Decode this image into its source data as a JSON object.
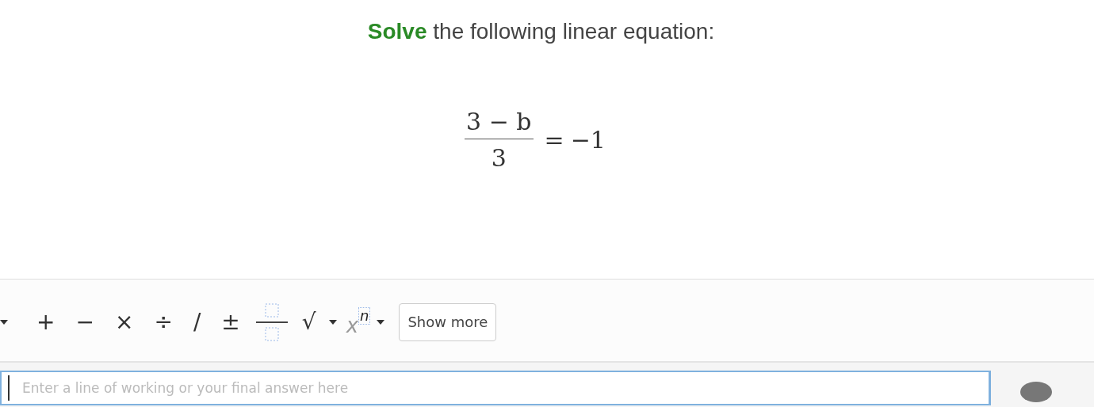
{
  "question": {
    "prompt": "**Solve** the following linear equation:",
    "equation": {
      "numerator": "3 − b",
      "denominator": "3",
      "relation": "=",
      "right_side": "−1"
    }
  },
  "toolbar": [
    {
      "kind": "caret"
    },
    {
      "kind": "symbol",
      "label": "+"
    },
    {
      "kind": "symbol",
      "label": "−"
    },
    {
      "kind": "symbol",
      "label": "×"
    },
    {
      "kind": "symbol",
      "label": "÷"
    },
    {
      "kind": "symbol",
      "label": "/"
    },
    {
      "kind": "symbol",
      "label": "±"
    },
    {
      "kind": "fraction"
    },
    {
      "kind": "symbol",
      "label": "√"
    },
    {
      "kind": "caret"
    },
    {
      "kind": "power",
      "label": "x",
      "exponent": "n"
    },
    {
      "kind": "caret"
    },
    {
      "kind": "button",
      "label": "Show more"
    }
  ],
  "answer": {
    "placeholder": "Enter a line of working or your final answer here"
  }
}
